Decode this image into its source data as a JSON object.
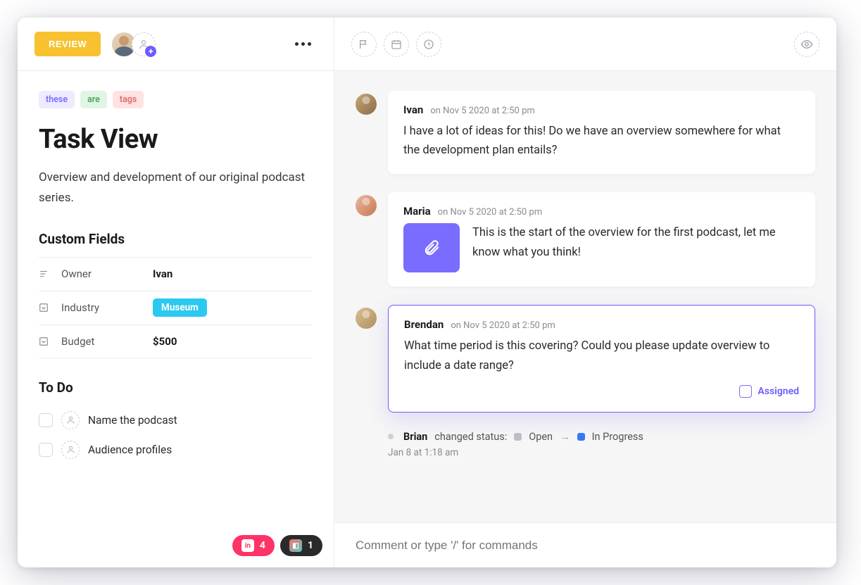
{
  "left": {
    "review_label": "REVIEW",
    "tags": [
      {
        "text": "these",
        "cls": "tag-purple"
      },
      {
        "text": "are",
        "cls": "tag-green"
      },
      {
        "text": "tags",
        "cls": "tag-red"
      }
    ],
    "title": "Task View",
    "description": "Overview and development of our original podcast series.",
    "custom_fields_heading": "Custom Fields",
    "fields": {
      "owner": {
        "label": "Owner",
        "value": "Ivan"
      },
      "industry": {
        "label": "Industry",
        "value": "Museum"
      },
      "budget": {
        "label": "Budget",
        "value": "$500"
      }
    },
    "todo_heading": "To Do",
    "todos": [
      {
        "label": "Name the podcast"
      },
      {
        "label": "Audience profiles"
      }
    ],
    "attachments": {
      "invision_count": "4",
      "figma_count": "1"
    }
  },
  "right": {
    "comments": [
      {
        "author": "Ivan",
        "time": "on Nov 5 2020 at 2:50 pm",
        "body": "I have a lot of ideas for this! Do we have an overview somewhere for what the development plan entails?"
      },
      {
        "author": "Maria",
        "time": "on Nov 5 2020 at 2:50 pm",
        "body": "This is the start of the overview for the first podcast, let me know what you think!"
      },
      {
        "author": "Brendan",
        "time": "on Nov 5 2020 at 2:50 pm",
        "body": "What time period is this covering? Could you please update overview to include a date range?",
        "assigned_label": "Assigned"
      }
    ],
    "status_event": {
      "author": "Brian",
      "action": "changed status:",
      "from": "Open",
      "to": "In Progress",
      "time": "Jan 8 at 1:18 am"
    },
    "input_placeholder": "Comment or type '/' for commands"
  }
}
